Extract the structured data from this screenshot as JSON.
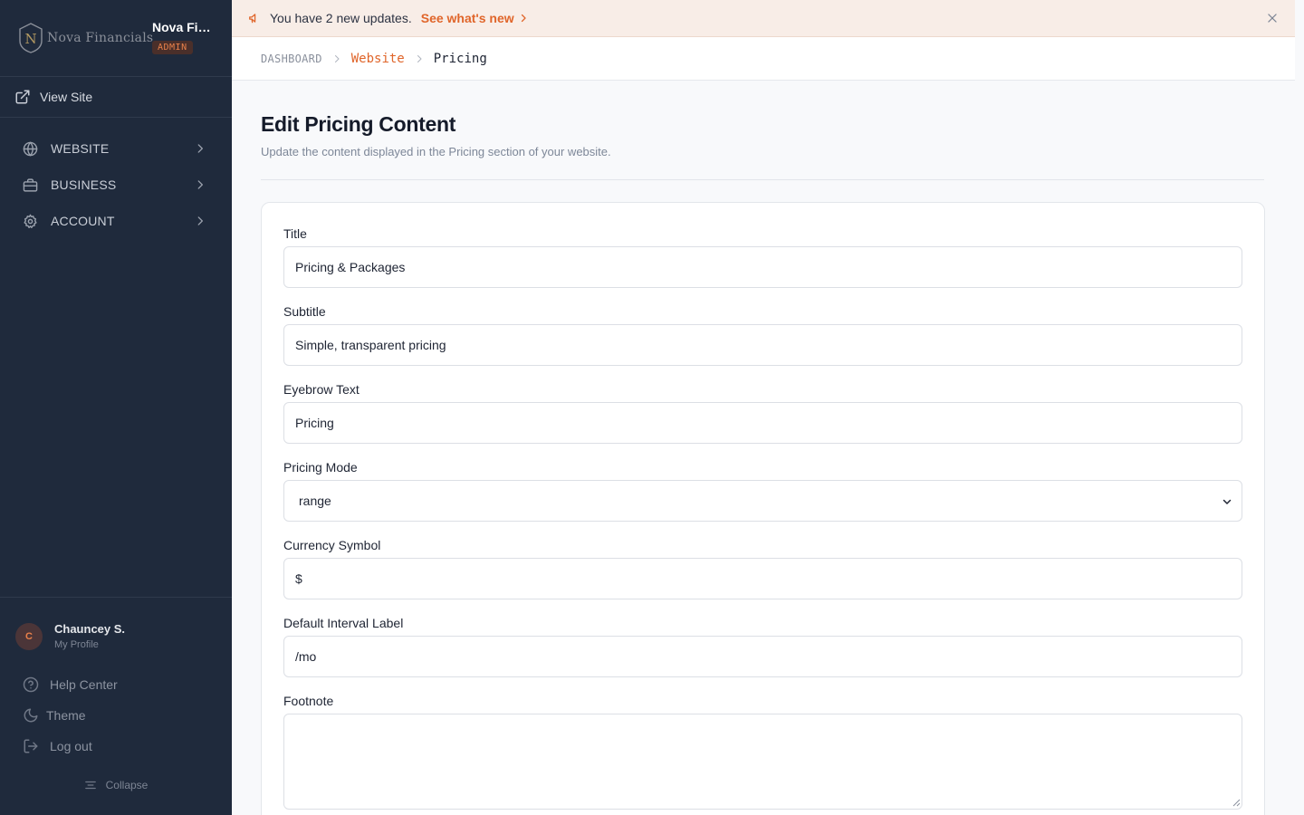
{
  "sidebar": {
    "logo_text": "Nova Financials",
    "brand_name": "Nova Financials",
    "role_badge": "ADMIN",
    "view_site_label": "View Site",
    "nav": [
      {
        "label": "WEBSITE",
        "icon": "globe-icon"
      },
      {
        "label": "BUSINESS",
        "icon": "briefcase-icon"
      },
      {
        "label": "ACCOUNT",
        "icon": "gear-icon"
      }
    ],
    "profile": {
      "initial": "C",
      "name": "Chauncey S.",
      "sub": "My Profile"
    },
    "footer": {
      "help": "Help Center",
      "theme": "Theme",
      "logout": "Log out",
      "collapse": "Collapse"
    }
  },
  "banner": {
    "message": "You have 2 new updates.",
    "link": "See what's new"
  },
  "breadcrumb": {
    "root": "DASHBOARD",
    "section": "Website",
    "current": "Pricing"
  },
  "page": {
    "title": "Edit Pricing Content",
    "subtitle": "Update the content displayed in the Pricing section of your website."
  },
  "form": {
    "title": {
      "label": "Title",
      "value": "Pricing & Packages"
    },
    "subtitle": {
      "label": "Subtitle",
      "value": "Simple, transparent pricing"
    },
    "eyebrow": {
      "label": "Eyebrow Text",
      "value": "Pricing"
    },
    "mode": {
      "label": "Pricing Mode",
      "value": "range"
    },
    "currency": {
      "label": "Currency Symbol",
      "value": "$"
    },
    "interval": {
      "label": "Default Interval Label",
      "value": "/mo"
    },
    "footnote": {
      "label": "Footnote",
      "value": ""
    }
  },
  "colors": {
    "sidebar_bg": "#1f2a3c",
    "accent": "#e0652a",
    "banner_bg": "#f8ede7"
  }
}
